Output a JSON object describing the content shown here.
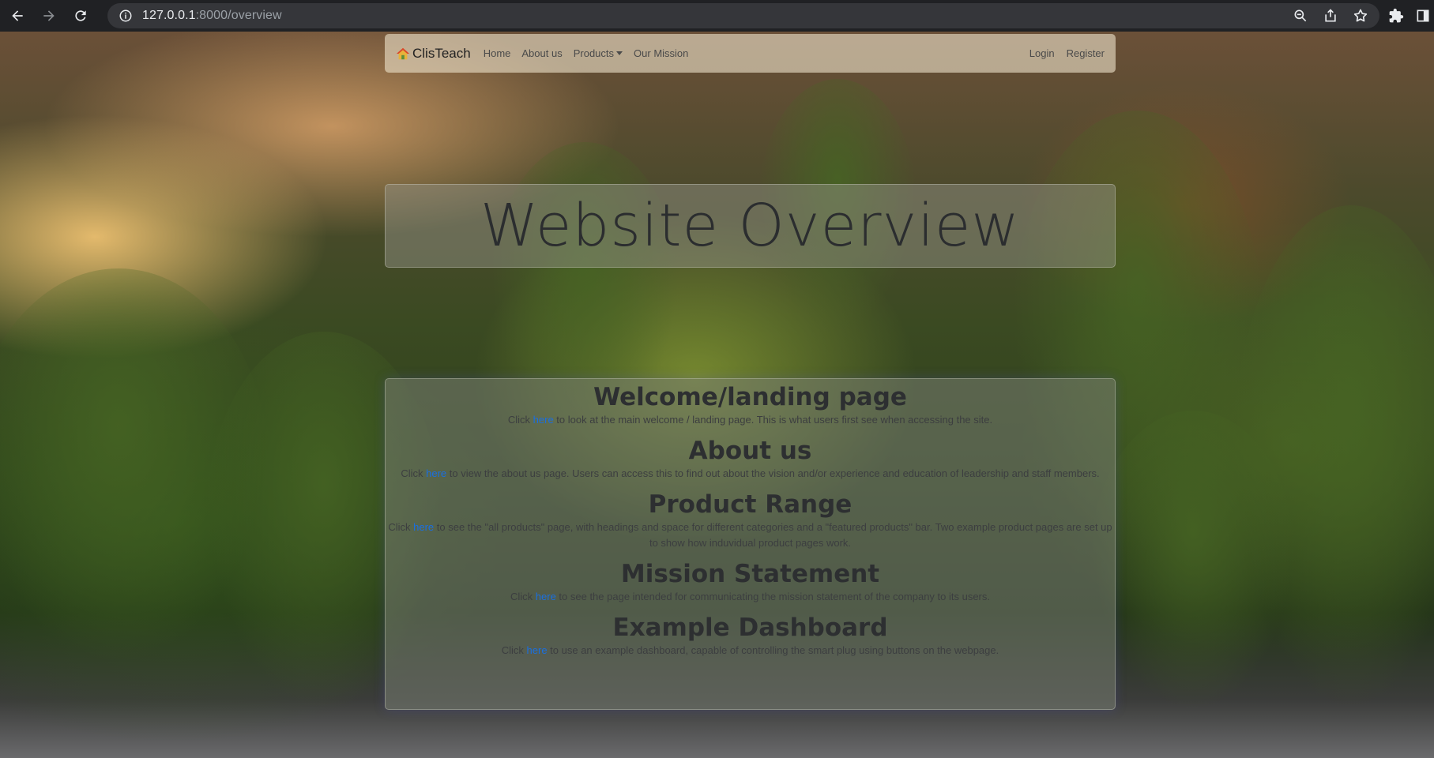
{
  "browser": {
    "url_host": "127.0.0.1",
    "url_path": ":8000/overview"
  },
  "navbar": {
    "brand": "ClisTeach",
    "links": [
      "Home",
      "About us",
      "Products",
      "Our Mission"
    ],
    "right_links": [
      "Login",
      "Register"
    ]
  },
  "title": "Website Overview",
  "sections": [
    {
      "heading": "Welcome/landing page",
      "pre": "Click ",
      "link": "here",
      "post": " to look at the main welcome / landing page. This is what users first see when accessing the site."
    },
    {
      "heading": "About us",
      "pre": "Click ",
      "link": "here",
      "post": " to view the about us page. Users can access this to find out about the vision and/or experience and education of leadership and staff members."
    },
    {
      "heading": "Product Range",
      "pre": "Click ",
      "link": "here",
      "post": " to see the \"all products\" page, with headings and space for different categories and a \"featured products\" bar. Two example product pages are set up to show how induvidual product pages work."
    },
    {
      "heading": "Mission Statement",
      "pre": "Click ",
      "link": "here",
      "post": " to see the page intended for communicating the mission statement of the company to its users."
    },
    {
      "heading": "Example Dashboard",
      "pre": "Click ",
      "link": "here",
      "post": " to use an example dashboard, capable of controlling the smart plug using buttons on the webpage."
    }
  ],
  "colors": {
    "link": "#1a6fe0",
    "browser_bg": "#202124",
    "omnibox_bg": "#35363a"
  }
}
